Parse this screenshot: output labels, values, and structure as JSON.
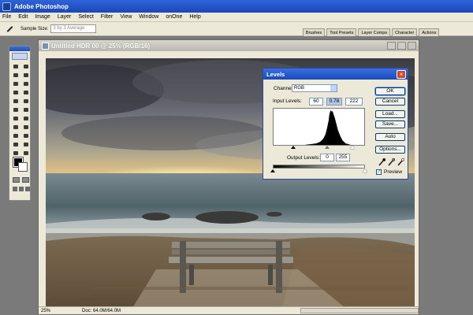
{
  "app": {
    "title": "Adobe Photoshop"
  },
  "menu": [
    "File",
    "Edit",
    "Image",
    "Layer",
    "Select",
    "Filter",
    "View",
    "Window",
    "onOne",
    "Help"
  ],
  "options_bar": {
    "tool_icon": "eyedropper-icon",
    "sample_size_label": "Sample Size:",
    "sample_size_value": "3 by 3 Average"
  },
  "palette_well": [
    "Brushes",
    "Tool Presets",
    "Layer Comps",
    "Character",
    "Actions"
  ],
  "document": {
    "title": "Untitled HDR 00 @ 25% (RGB/16)",
    "zoom": "25%",
    "doc_size": "Doc: 64.0M/64.0M"
  },
  "levels": {
    "title": "Levels",
    "channel_label": "Channel:",
    "channel_value": "RGB",
    "input_levels_label": "Input Levels:",
    "input_black": "60",
    "input_gamma": "0.78",
    "input_white": "222",
    "output_levels_label": "Output Levels:",
    "output_black": "0",
    "output_white": "255",
    "buttons": {
      "ok": "OK",
      "cancel": "Cancel",
      "load": "Load...",
      "save": "Save...",
      "auto": "Auto",
      "options": "Options..."
    },
    "preview_label": "Preview",
    "preview_checked": true,
    "eyedropper_colors": [
      "#000000",
      "#808080",
      "#ffffff"
    ]
  },
  "colors": {
    "title_bar": "#1f4fc4",
    "chrome": "#ece9d8",
    "close_button": "#d04a2a"
  }
}
